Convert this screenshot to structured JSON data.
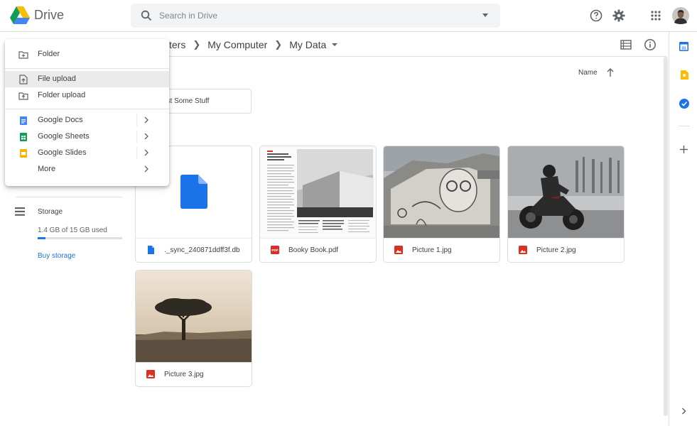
{
  "app": {
    "name": "Drive"
  },
  "search": {
    "placeholder": "Search in Drive"
  },
  "breadcrumb": {
    "partial_root": "ters",
    "items": [
      "My Computer",
      "My Data"
    ]
  },
  "sort": {
    "label": "Name",
    "direction": "ascending"
  },
  "folders": [
    {
      "name": "ust Some Stuff"
    }
  ],
  "files": [
    {
      "name": "._sync_240871ddff3f.db",
      "type": "doc",
      "thumb": "doc"
    },
    {
      "name": "Booky Book.pdf",
      "type": "pdf",
      "thumb": "book"
    },
    {
      "name": "Picture 1.jpg",
      "type": "image",
      "thumb": "mural"
    },
    {
      "name": "Picture 2.jpg",
      "type": "image",
      "thumb": "moto"
    },
    {
      "name": "Picture 3.jpg",
      "type": "image",
      "thumb": "tree"
    }
  ],
  "new_menu": {
    "folder": "Folder",
    "file_upload": "File upload",
    "folder_upload": "Folder upload",
    "google_docs": "Google Docs",
    "google_sheets": "Google Sheets",
    "google_slides": "Google Slides",
    "more": "More"
  },
  "sidebar": {
    "storage_label": "Storage",
    "storage_used_text": "1.4 GB of 15 GB used",
    "storage_used_fraction": 0.093,
    "buy_storage": "Buy storage"
  },
  "right_panel": {
    "icons": [
      "calendar-icon",
      "keep-icon",
      "tasks-icon",
      "add-icon",
      "expand-icon"
    ],
    "calendar_day": "31"
  },
  "colors": {
    "accent": "#1a73e8",
    "docs": "#4285f4",
    "sheets": "#0f9d58",
    "slides": "#f4b400",
    "pdf": "#d93025",
    "keep": "#fbbc04"
  }
}
